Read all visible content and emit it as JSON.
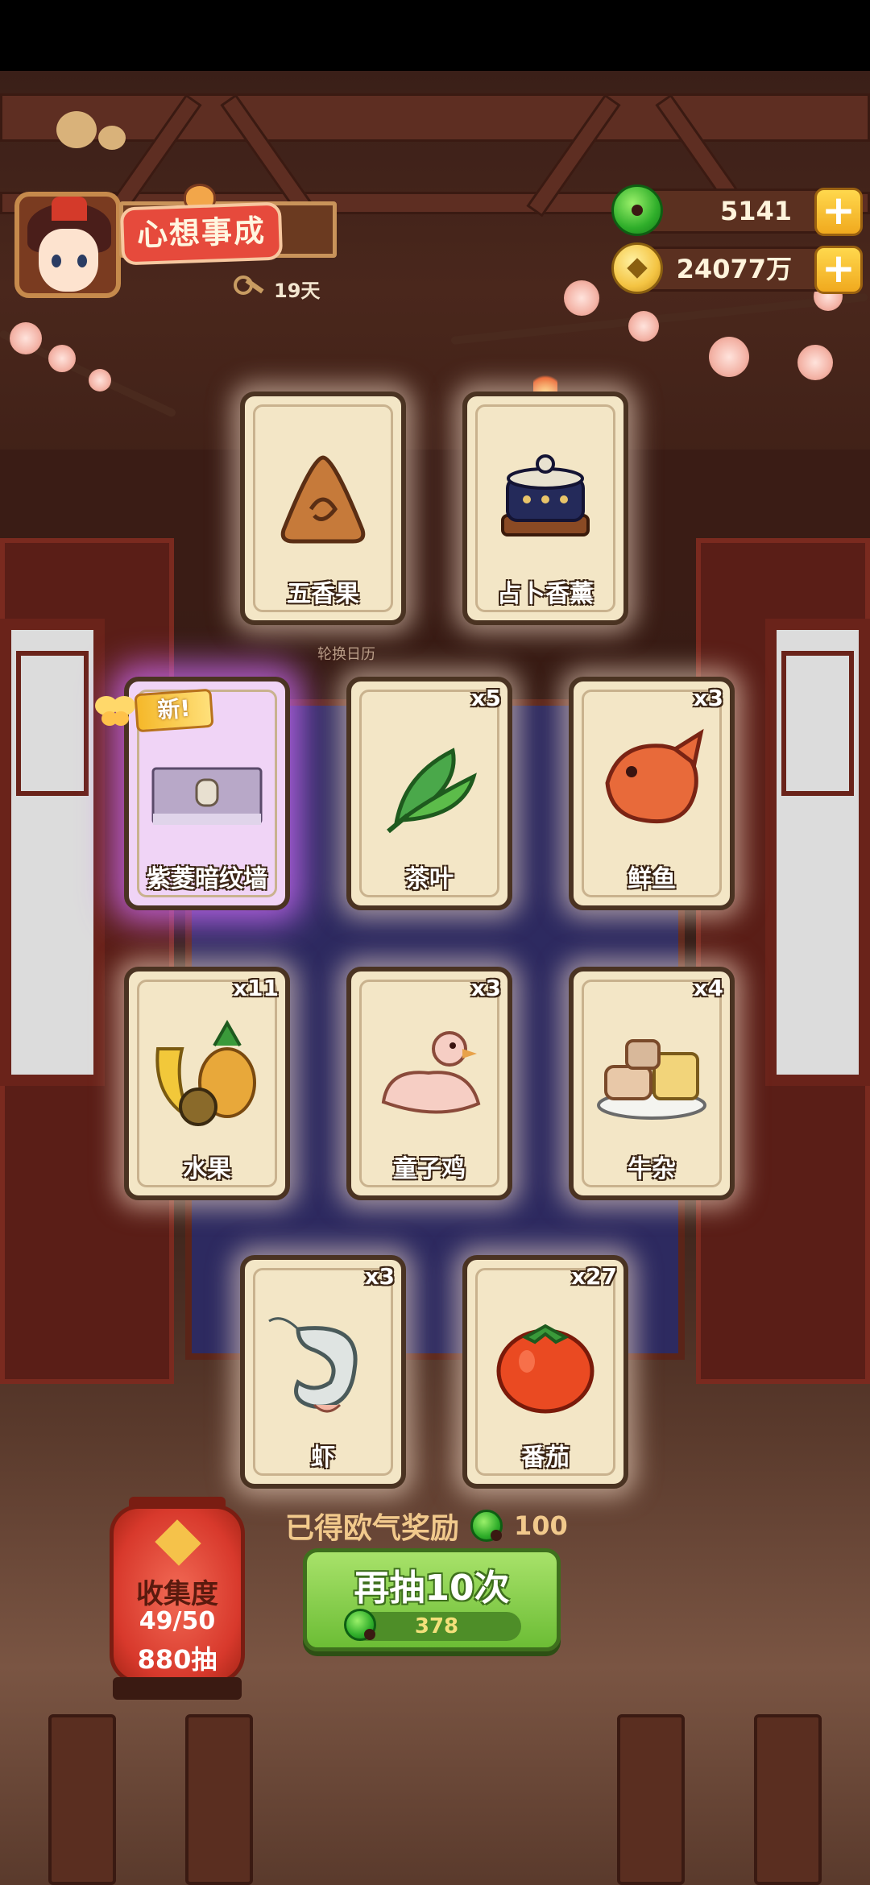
{
  "hud": {
    "player_title": "心想事成",
    "days": "19天",
    "jade_amount": "5141",
    "gold_amount": "24077万",
    "plus_label": "+"
  },
  "board": {
    "rotate_label": "轮换日历"
  },
  "cards": [
    {
      "name": "五香果",
      "count": "",
      "new": false,
      "icon": "five-spice-fruit-icon"
    },
    {
      "name": "占卜香薰",
      "count": "",
      "new": false,
      "icon": "incense-burner-icon"
    },
    {
      "name": "紫菱暗纹墙",
      "count": "",
      "new": true,
      "icon": "purple-wall-icon"
    },
    {
      "name": "茶叶",
      "count": "x5",
      "new": false,
      "icon": "tea-leaf-icon"
    },
    {
      "name": "鲜鱼",
      "count": "x3",
      "new": false,
      "icon": "fish-icon"
    },
    {
      "name": "水果",
      "count": "x11",
      "new": false,
      "icon": "fruit-icon"
    },
    {
      "name": "童子鸡",
      "count": "x3",
      "new": false,
      "icon": "chicken-icon"
    },
    {
      "name": "牛杂",
      "count": "x4",
      "new": false,
      "icon": "beef-offal-icon"
    },
    {
      "name": "虾",
      "count": "x3",
      "new": false,
      "icon": "shrimp-icon"
    },
    {
      "name": "番茄",
      "count": "x27",
      "new": false,
      "icon": "tomato-icon"
    }
  ],
  "new_badge": "新!",
  "reward": {
    "text": "已得欧气奖励",
    "value": "100"
  },
  "draw_button": {
    "label": "再抽10次",
    "cost": "378"
  },
  "collection": {
    "title": "收集度",
    "progress": "49/50",
    "draws": "880抽"
  },
  "colors": {
    "jade": "#2fae2a",
    "gold": "#f4c443",
    "card_bg": "#f3e6c6",
    "button_green": "#6cbd35",
    "lantern_red": "#d8392c"
  }
}
